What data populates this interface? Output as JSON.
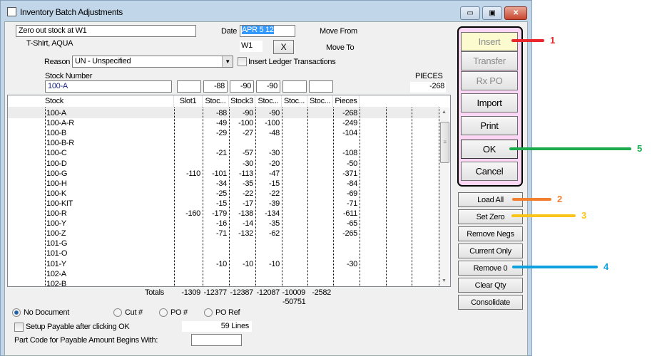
{
  "window": {
    "title": "Inventory Batch Adjustments"
  },
  "form": {
    "description": "Zero out stock at W1",
    "date_label": "Date",
    "date_value": "APR 5 12",
    "item_name": "T-Shirt, AQUA",
    "location_value": "W1",
    "clear_button": "X",
    "move_from_label": "Move From",
    "move_to_label": "Move To",
    "reason_label": "Reason",
    "reason_value": "UN - Unspecified",
    "insert_ledger_label": "Insert Ledger Transactions",
    "insert_ledger_checked": false,
    "stock_number_label": "Stock Number",
    "stock_number_value": "100-A",
    "slot_values": [
      "",
      "-88",
      "-90",
      "-90",
      "",
      ""
    ],
    "pieces_label": "PIECES",
    "pieces_value": "-268"
  },
  "grid": {
    "columns": [
      "Stock",
      "Slot1",
      "Stoc...",
      "Stock3",
      "Stoc...",
      "Stoc...",
      "Stoc...",
      "Pieces"
    ],
    "rows": [
      [
        "100-A",
        "",
        "-88",
        "-90",
        "-90",
        "",
        "",
        "-268"
      ],
      [
        "100-A-R",
        "",
        "-49",
        "-100",
        "-100",
        "",
        "",
        "-249"
      ],
      [
        "100-B",
        "",
        "-29",
        "-27",
        "-48",
        "",
        "",
        "-104"
      ],
      [
        "100-B-R",
        "",
        "",
        "",
        "",
        "",
        "",
        ""
      ],
      [
        "100-C",
        "",
        "-21",
        "-57",
        "-30",
        "",
        "",
        "-108"
      ],
      [
        "100-D",
        "",
        "",
        "-30",
        "-20",
        "",
        "",
        "-50"
      ],
      [
        "100-G",
        "-110",
        "-101",
        "-113",
        "-47",
        "",
        "",
        "-371"
      ],
      [
        "100-H",
        "",
        "-34",
        "-35",
        "-15",
        "",
        "",
        "-84"
      ],
      [
        "100-K",
        "",
        "-25",
        "-22",
        "-22",
        "",
        "",
        "-69"
      ],
      [
        "100-KIT",
        "",
        "-15",
        "-17",
        "-39",
        "",
        "",
        "-71"
      ],
      [
        "100-R",
        "-160",
        "-179",
        "-138",
        "-134",
        "",
        "",
        "-611"
      ],
      [
        "100-Y",
        "",
        "-16",
        "-14",
        "-35",
        "",
        "",
        "-65"
      ],
      [
        "100-Z",
        "",
        "-71",
        "-132",
        "-62",
        "",
        "",
        "-265"
      ],
      [
        "101-G",
        "",
        "",
        "",
        "",
        "",
        "",
        ""
      ],
      [
        "101-O",
        "",
        "",
        "",
        "",
        "",
        "",
        ""
      ],
      [
        "101-Y",
        "",
        "-10",
        "-10",
        "-10",
        "",
        "",
        "-30"
      ],
      [
        "102-A",
        "",
        "",
        "",
        "",
        "",
        "",
        ""
      ],
      [
        "102-B",
        "",
        "",
        "",
        "",
        "",
        "",
        ""
      ]
    ],
    "totals_label": "Totals",
    "totals": [
      "-1309",
      "-12377",
      "-12387",
      "-12087",
      "-10009",
      "-2582"
    ],
    "grand_total": "-50751"
  },
  "document": {
    "options": [
      "No Document",
      "Cut #",
      "PO #",
      "PO Ref"
    ],
    "selected": "No Document",
    "setup_payable_label": "Setup Payable after clicking OK",
    "setup_payable_checked": false,
    "lines": "59 Lines",
    "part_code_label": "Part Code for Payable Amount Begins With:",
    "part_code_value": ""
  },
  "buttons": {
    "main": [
      {
        "label": "Insert",
        "enabled": false
      },
      {
        "label": "Transfer",
        "enabled": false
      },
      {
        "label": "Rx PO",
        "enabled": false
      },
      {
        "label": "Import",
        "enabled": true
      },
      {
        "label": "Print",
        "enabled": true
      },
      {
        "label": "OK",
        "enabled": true
      },
      {
        "label": "Cancel",
        "enabled": true
      }
    ],
    "tools": [
      "Load All",
      "Set Zero",
      "Remove Negs",
      "Current Only",
      "Remove 0",
      "Clear Qty",
      "Consolidate"
    ]
  },
  "annotations": [
    {
      "label": "1",
      "color": "#e8262b"
    },
    {
      "label": "2",
      "color": "#f07f30"
    },
    {
      "label": "3",
      "color": "#fcc419"
    },
    {
      "label": "4",
      "color": "#0fa0e0"
    },
    {
      "label": "5",
      "color": "#1aaa4b"
    }
  ],
  "colors": {
    "highlight_group": "#fbd6f5",
    "selection": "#3399ff",
    "insert_bg": "#fbfbcf"
  }
}
